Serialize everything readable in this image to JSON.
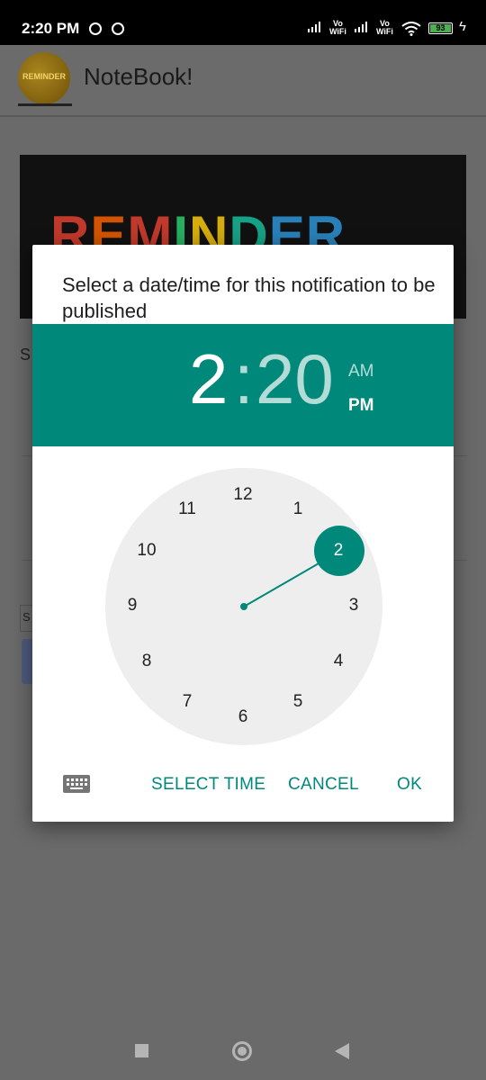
{
  "status": {
    "time": "2:20 PM",
    "battery": "93",
    "network": "Vo WiFi"
  },
  "app": {
    "title": "NoteBook!",
    "logo_text": "REMINDER"
  },
  "background": {
    "banner_text": "REMINDER",
    "label_s": "S",
    "input_s": "S"
  },
  "dialog": {
    "title": "Select a date/time for this notification to be published",
    "hour": "2",
    "separator": ":",
    "minute": "20",
    "am": "AM",
    "pm": "PM",
    "selected_hour": "2",
    "clock_numbers": [
      "12",
      "1",
      "2",
      "3",
      "4",
      "5",
      "6",
      "7",
      "8",
      "9",
      "10",
      "11"
    ],
    "actions": {
      "select_time": "SELECT TIME",
      "cancel": "CANCEL",
      "ok": "OK"
    }
  },
  "colors": {
    "accent": "#00897b",
    "dial": "#eeeeee",
    "scrim": "#6a6a6a"
  },
  "icons": {
    "keyboard": "keyboard-icon",
    "nav_recent": "square-icon",
    "nav_home": "circle-icon",
    "nav_back": "triangle-back-icon"
  }
}
